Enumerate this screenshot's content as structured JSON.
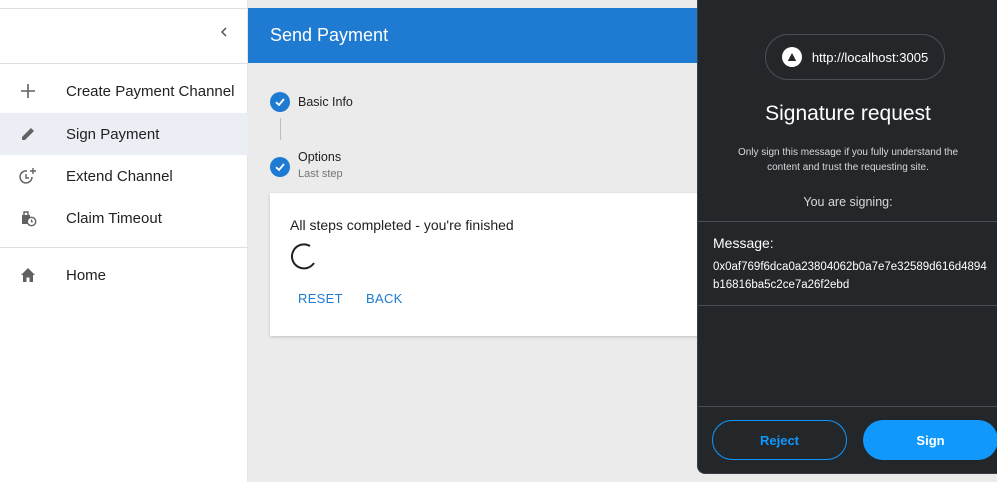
{
  "sidebar": {
    "collapse_icon": "chevron-left-icon",
    "items": [
      {
        "label": "Create Payment Channel",
        "icon": "plus-icon"
      },
      {
        "label": "Sign Payment",
        "icon": "pencil-icon",
        "selected": true
      },
      {
        "label": "Extend Channel",
        "icon": "clock-plus-icon"
      },
      {
        "label": "Claim Timeout",
        "icon": "bag-clock-icon"
      },
      {
        "label": "Home",
        "icon": "home-icon"
      }
    ]
  },
  "appbar": {
    "title": "Send Payment",
    "color": "#1e7bd1"
  },
  "stepper": {
    "steps": [
      {
        "label": "Basic Info",
        "completed": true
      },
      {
        "label": "Options",
        "sublabel": "Last step",
        "completed": true
      }
    ]
  },
  "completion": {
    "message": "All steps completed - you're finished",
    "reset_label": "RESET",
    "back_label": "BACK"
  },
  "signature_popup": {
    "origin": "http://localhost:3005",
    "title": "Signature request",
    "warning": "Only sign this message if you fully understand the content and trust the requesting site.",
    "you_are_signing": "You are signing:",
    "message_label": "Message:",
    "message": "0x0af769f6dca0a23804062b0a7e7e32589d616d4894b16816ba5c2ce7a26f2ebd",
    "reject_label": "Reject",
    "sign_label": "Sign",
    "accent": "#1098fc"
  }
}
